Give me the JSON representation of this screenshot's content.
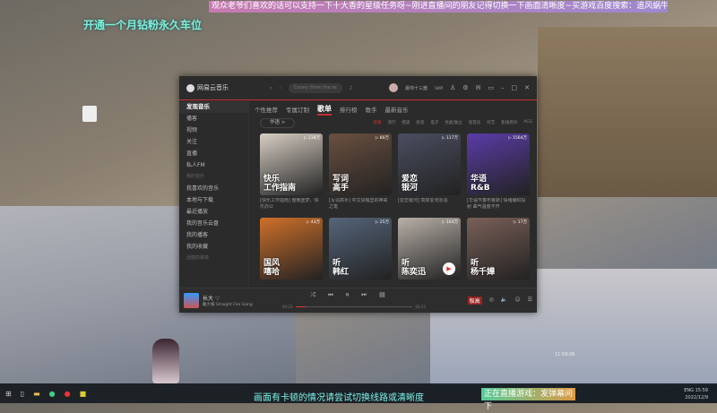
{
  "overlay": {
    "banner": "观众老爷们喜欢的话可以支持一下十大香的星级任务呀~刚进直播间的朋友记得切换一下画面清晰度~买游戏百度搜索：追风蜗牛游戏",
    "gift_text": "开通一个月钻粉永久车位",
    "subtitle": "画面有卡顿的情况请尝试切换线路或清晰度",
    "live_status": "正在直播游戏：发弹幕问下",
    "screen_time": "11:59:06"
  },
  "app": {
    "name": "网易云音乐",
    "search_placeholder": "Coney (from the se",
    "user": "最帅十三酱",
    "vip": "SVIP"
  },
  "sidebar": {
    "items": [
      "发现音乐",
      "播客",
      "视频",
      "关注",
      "直播",
      "私人FM"
    ],
    "my_music_header": "我的音乐",
    "my_items": [
      "我喜欢的音乐",
      "本地与下载",
      "最近播放",
      "我的音乐云盘",
      "我的播客",
      "我的收藏"
    ],
    "created_header": "创建的歌单"
  },
  "tabs": [
    "个性推荐",
    "专属订制",
    "歌单",
    "排行榜",
    "歌手",
    "最新音乐"
  ],
  "filter": {
    "current": "华语 >",
    "tags": [
      "华语",
      "流行",
      "摇滚",
      "民谣",
      "电子",
      "另类/独立",
      "轻音乐",
      "综艺",
      "影视原声",
      "ACG"
    ]
  },
  "playlists": [
    {
      "cover": "快乐\n工作指南",
      "count": "▷ 238万",
      "desc": "[快乐工作指南] 整晚噩梦，快乐办公",
      "color": "#d8cfc4"
    },
    {
      "cover": "写词\n高手",
      "count": "▷ 80万",
      "desc": "[写词高手] 中文说唱里的神来之笔",
      "color": "#6a5040"
    },
    {
      "cover": "爱恋\n银河",
      "count": "▷ 117万",
      "desc": "[爱恋银河] 真挚爱河永浴",
      "color": "#4a4e60"
    },
    {
      "cover": "华语\nR&B",
      "count": "▷ 1564万",
      "desc": "[华语节奏布鲁斯] 情绪编织投射 曲气温度不开",
      "color": "#5b3ca8"
    },
    {
      "cover": "国风\n嘻哈",
      "count": "▷ 43万",
      "desc": "",
      "color": "#d0702a"
    },
    {
      "cover": "听\n韩红",
      "count": "▷ 25万",
      "desc": "",
      "color": "#55657a"
    },
    {
      "cover": "听\n陈奕迅",
      "count": "▷ 103万",
      "desc": "",
      "color": "#b8b0a8"
    },
    {
      "cover": "听\n杨千嬅",
      "count": "▷ 17万",
      "desc": "",
      "color": "#7a6058"
    }
  ],
  "player": {
    "title": "长大 ♡",
    "artist": "戴大耀 Straight Fire Gang",
    "elapsed": "00:23",
    "duration": "04:23",
    "progress": 0.09,
    "quality": "极高"
  },
  "taskbar": {
    "time": "15:59",
    "date": "2022/12/9",
    "lang": "ENG"
  }
}
